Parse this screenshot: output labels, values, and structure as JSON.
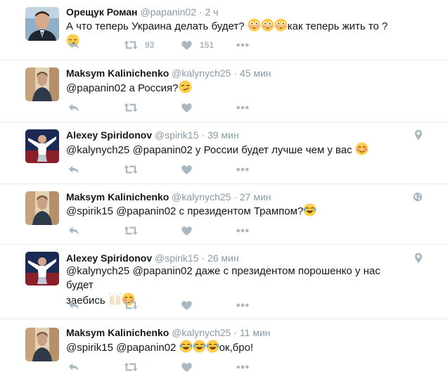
{
  "colors": {
    "icon": "#aab8c2",
    "muted": "#8899a6",
    "text": "#14171a",
    "divider": "#e6ecf0"
  },
  "tweets": [
    {
      "name": "Орещук Роман",
      "handle": "@papanin02",
      "sep": "·",
      "time": "2 ч",
      "text_before": "А что теперь Украина делать будет?",
      "emojis_mid": [
        "flushed-face",
        "flushed-face",
        "flushed-face"
      ],
      "text_after": "как теперь жить то ?",
      "emoji_end": "disappointed-face",
      "retweets": "93",
      "likes": "151"
    },
    {
      "name": "Maksym Kalinichenko",
      "handle": "@kalynych25",
      "sep": "·",
      "time": "45 мин",
      "text": "@papanin02 а Россия?",
      "emoji_end": "smirking-face"
    },
    {
      "name": "Alexey Spiridonov",
      "handle": "@spirik15",
      "sep": "·",
      "time": "39 мин",
      "text": "@kalynych25 @papanin02 у России будет лучше чем у вас",
      "emoji_end": "relieved-blushing-face",
      "corner_icon": "location-pin-icon"
    },
    {
      "name": "Maksym Kalinichenko",
      "handle": "@kalynych25",
      "sep": "·",
      "time": "27 мин",
      "text": "@spirik15 @papanin02 с президентом Трампом?",
      "emoji_end": "tears-of-joy-face",
      "corner_icon": "globe-icon"
    },
    {
      "name": "Alexey Spiridonov",
      "handle": "@spirik15",
      "sep": "·",
      "time": "26 мин",
      "text": "@kalynych25 @papanin02 даже с президентом порошенко у нас будет",
      "text_line2": "заебись",
      "emojis_line2": [
        "raised-hands",
        "relieved-blushing-face"
      ],
      "corner_icon": "location-pin-icon"
    },
    {
      "name": "Maksym Kalinichenko",
      "handle": "@kalynych25",
      "sep": "·",
      "time": "11 мин",
      "text_before": "@spirik15 @papanin02",
      "emojis_mid": [
        "tears-of-joy-face",
        "tears-of-joy-face",
        "tears-of-joy-face"
      ],
      "text_after": "ок,бро!"
    }
  ]
}
